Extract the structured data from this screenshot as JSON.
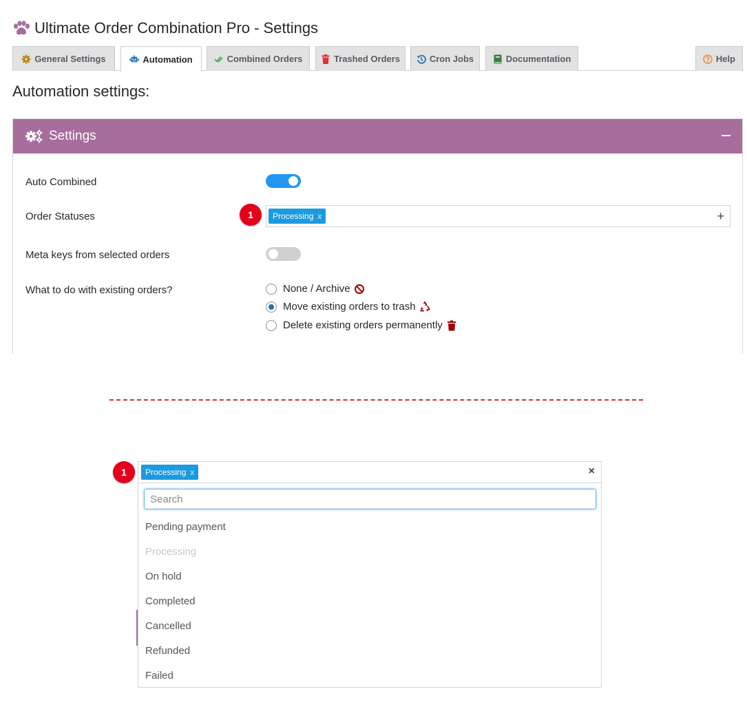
{
  "header": {
    "title": "Ultimate Order Combination Pro - Settings"
  },
  "tabs": [
    {
      "label": "General Settings",
      "icon": "gear-icon",
      "color": "#b8860b"
    },
    {
      "label": "Automation",
      "icon": "robot-icon",
      "color": "#2271b1",
      "active": true
    },
    {
      "label": "Combined Orders",
      "icon": "double-check-icon",
      "color": "#46b450"
    },
    {
      "label": "Trashed Orders",
      "icon": "trash-icon",
      "color": "#dc3232"
    },
    {
      "label": "Cron Jobs",
      "icon": "history-icon",
      "color": "#2271b1"
    },
    {
      "label": "Documentation",
      "icon": "book-icon",
      "color": "#3c7a3c"
    },
    {
      "label": "Help",
      "icon": "question-icon",
      "color": "#f08c3a"
    }
  ],
  "section_title": "Automation settings:",
  "panel": {
    "title": "Settings",
    "header_color": "#a76d9d",
    "rows": {
      "auto_combined": {
        "label": "Auto Combined",
        "enabled": true
      },
      "order_statuses": {
        "label": "Order Statuses",
        "selected_chip": "Processing",
        "chip_remove": "x",
        "add_symbol": "+"
      },
      "meta_keys": {
        "label": "Meta keys from selected orders",
        "enabled": false
      },
      "existing_orders": {
        "label": "What to do with existing orders?",
        "options": [
          {
            "label": "None / Archive",
            "icon": "ban-icon",
            "checked": false
          },
          {
            "label": "Move existing orders to trash",
            "icon": "recycle-icon",
            "checked": true
          },
          {
            "label": "Delete existing orders permanently",
            "icon": "trash-icon",
            "checked": false
          }
        ]
      }
    }
  },
  "callout_number": "1",
  "dropdown": {
    "selected_chip": "Processing",
    "chip_remove": "x",
    "clear_symbol": "×",
    "search_placeholder": "Search",
    "options": [
      {
        "label": "Pending payment",
        "disabled": false
      },
      {
        "label": "Processing",
        "disabled": true
      },
      {
        "label": "On hold",
        "disabled": false
      },
      {
        "label": "Completed",
        "disabled": false
      },
      {
        "label": "Cancelled",
        "disabled": false
      },
      {
        "label": "Refunded",
        "disabled": false
      },
      {
        "label": "Failed",
        "disabled": false
      }
    ]
  },
  "colors": {
    "accent_blue": "#2196f3",
    "chip_blue": "#1b9ae0",
    "badge_red": "#e3001b",
    "divider_red": "#c0392b"
  }
}
